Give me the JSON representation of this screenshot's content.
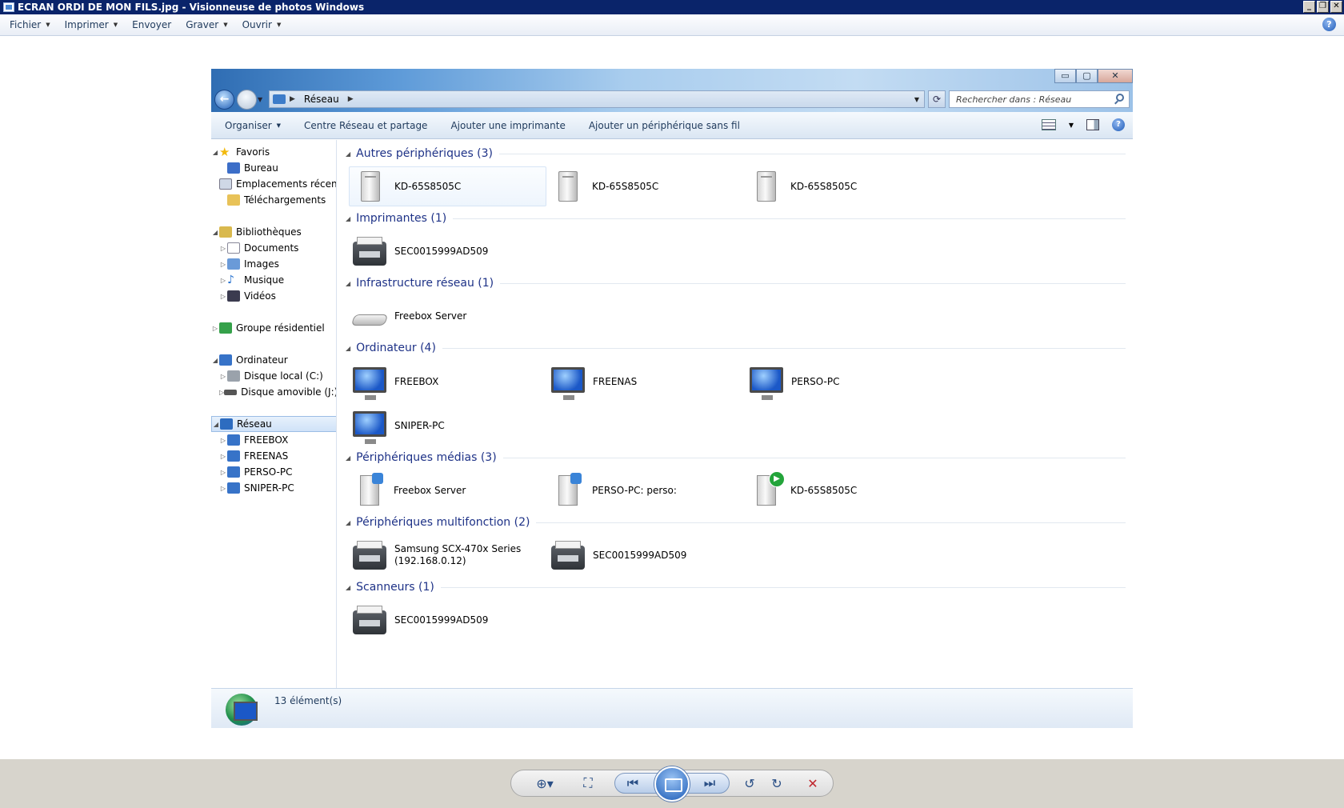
{
  "viewer": {
    "title": "ECRAN ORDI DE MON FILS.jpg - Visionneuse de photos Windows",
    "menu": [
      "Fichier",
      "Imprimer",
      "Envoyer",
      "Graver",
      "Ouvrir"
    ]
  },
  "explorer": {
    "breadcrumb": "Réseau",
    "search_placeholder": "Rechercher dans : Réseau",
    "commands": {
      "organize": "Organiser",
      "network_center": "Centre Réseau et partage",
      "add_printer": "Ajouter une imprimante",
      "add_wireless": "Ajouter un périphérique sans fil"
    },
    "nav": {
      "favorites": "Favoris",
      "desktop": "Bureau",
      "recent": "Emplacements récents",
      "downloads": "Téléchargements",
      "libraries": "Bibliothèques",
      "documents": "Documents",
      "images": "Images",
      "music": "Musique",
      "videos": "Vidéos",
      "homegroup": "Groupe résidentiel",
      "computer": "Ordinateur",
      "local_disk": "Disque local (C:)",
      "removable": "Disque amovible (J:)",
      "network": "Réseau",
      "network_children": [
        "FREEBOX",
        "FREENAS",
        "PERSO-PC",
        "SNIPER-PC"
      ]
    },
    "groups": {
      "other": {
        "title": "Autres périphériques (3)",
        "items": [
          "KD-65S8505C",
          "KD-65S8505C",
          "KD-65S8505C"
        ]
      },
      "printers": {
        "title": "Imprimantes (1)",
        "items": [
          "SEC0015999AD509"
        ]
      },
      "infra": {
        "title": "Infrastructure réseau (1)",
        "items": [
          "Freebox Server"
        ]
      },
      "computers": {
        "title": "Ordinateur (4)",
        "items": [
          "FREEBOX",
          "FREENAS",
          "PERSO-PC",
          "SNIPER-PC"
        ]
      },
      "media": {
        "title": "Périphériques médias (3)",
        "items": [
          "Freebox Server",
          "PERSO-PC: perso:",
          "KD-65S8505C"
        ]
      },
      "mfp": {
        "title": "Périphériques multifonction (2)",
        "items": [
          "Samsung SCX-470x Series",
          "(192.168.0.12)",
          "SEC0015999AD509"
        ]
      },
      "scanners": {
        "title": "Scanneurs (1)",
        "items": [
          "SEC0015999AD509"
        ]
      }
    },
    "status": "13 élément(s)"
  }
}
